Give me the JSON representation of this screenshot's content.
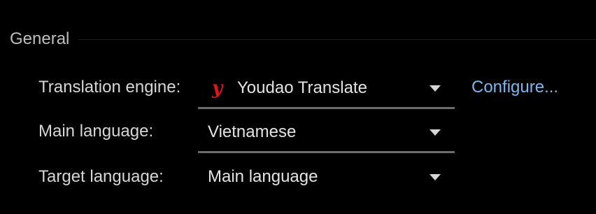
{
  "section": {
    "title": "General"
  },
  "rows": {
    "translation_engine": {
      "label": "Translation engine:",
      "value": "Youdao Translate",
      "icon": "youdao-logo-icon",
      "icon_glyph": "y",
      "icon_color": "#e8121b",
      "link": "Configure..."
    },
    "main_language": {
      "label": "Main language:",
      "value": "Vietnamese"
    },
    "target_language": {
      "label": "Target language:",
      "value": "Main language"
    }
  },
  "colors": {
    "background": "#000000",
    "link": "#7ab7f0",
    "underline": "#6b6b6b"
  }
}
